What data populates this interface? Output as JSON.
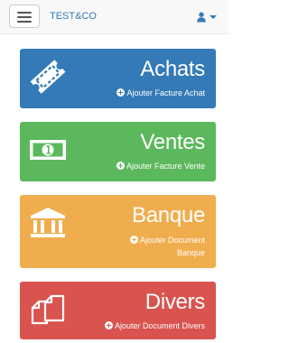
{
  "navbar": {
    "brand": "TEST&CO",
    "menu_icon": "hamburger-icon",
    "user_icon": "user-icon",
    "caret_icon": "caret-down-icon",
    "colors": {
      "background": "#f8f8f8",
      "link": "#337ab7"
    }
  },
  "tiles": [
    {
      "title": "Achats",
      "action": "Ajouter Facture Achat",
      "icon": "ticket-icon",
      "color": "#337ab7"
    },
    {
      "title": "Ventes",
      "action": "Ajouter Facture Vente",
      "icon": "money-icon",
      "color": "#5cb85c"
    },
    {
      "title": "Banque",
      "action": "Ajouter Document Banque",
      "icon": "bank-icon",
      "color": "#f0ad4e"
    },
    {
      "title": "Divers",
      "action": "Ajouter Document Divers",
      "icon": "files-icon",
      "color": "#d9534f"
    }
  ]
}
